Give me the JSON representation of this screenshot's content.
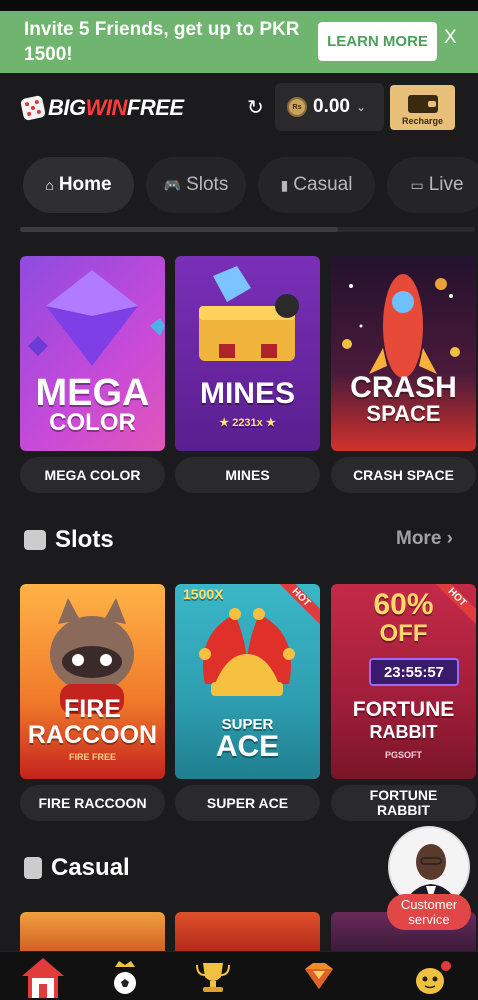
{
  "banner": {
    "text": "Invite 5 Friends, get up to PKR 1500!",
    "button": "LEARN MORE",
    "close": "X"
  },
  "header": {
    "logo_big": "BIG",
    "logo_win": "WIN",
    "logo_free": "FREE",
    "refresh_icon": "↻",
    "currency_symbol": "Rs",
    "balance": "0.00",
    "recharge_label": "Recharge"
  },
  "tabs": [
    {
      "label": "Home",
      "icon": "home-icon",
      "active": true
    },
    {
      "label": "Slots",
      "icon": "gamepad-icon",
      "active": false
    },
    {
      "label": "Casual",
      "icon": "cards-icon",
      "active": false
    },
    {
      "label": "Live",
      "icon": "live-icon",
      "active": false
    }
  ],
  "featured": [
    {
      "title_line1": "MEGA",
      "title_line2": "COLOR",
      "label": "MEGA COLOR"
    },
    {
      "title_line1": "MINES",
      "title_line2": "★ 2231x ★",
      "label": "MINES"
    },
    {
      "title_line1": "CRASH",
      "title_line2": "SPACE",
      "label": "CRASH SPACE"
    }
  ],
  "slots": {
    "title": "Slots",
    "more": "More",
    "games": [
      {
        "title_line1": "FIRE",
        "title_line2": "RACCOON",
        "provider": "FIRE FREE",
        "label": "FIRE RACCOON",
        "hot": false
      },
      {
        "top_tag": "1500X",
        "title_line1": "SUPER",
        "title_line2": "ACE",
        "label": "SUPER ACE",
        "hot": true,
        "hot_label": "HOT"
      },
      {
        "promo": "60%",
        "promo2": "OFF",
        "timer": "23:55:57",
        "title_line1": "FORTUNE",
        "title_line2": "RABBIT",
        "provider": "PGSOFT",
        "label": "FORTUNE RABBIT",
        "hot": true,
        "hot_label": "HOT"
      }
    ]
  },
  "casual": {
    "title": "Casual"
  },
  "customer_service": {
    "label": "Customer service"
  },
  "bottom_nav": [
    {
      "icon": "home-icon"
    },
    {
      "icon": "sports-icon"
    },
    {
      "icon": "trophy-icon"
    },
    {
      "icon": "vip-icon"
    },
    {
      "icon": "profile-icon"
    }
  ],
  "colors": {
    "banner_bg": "#6fb56f",
    "accent_red": "#ff3b3b",
    "recharge_bg": "#e8c07a",
    "page_bg": "#1b1b1d"
  }
}
